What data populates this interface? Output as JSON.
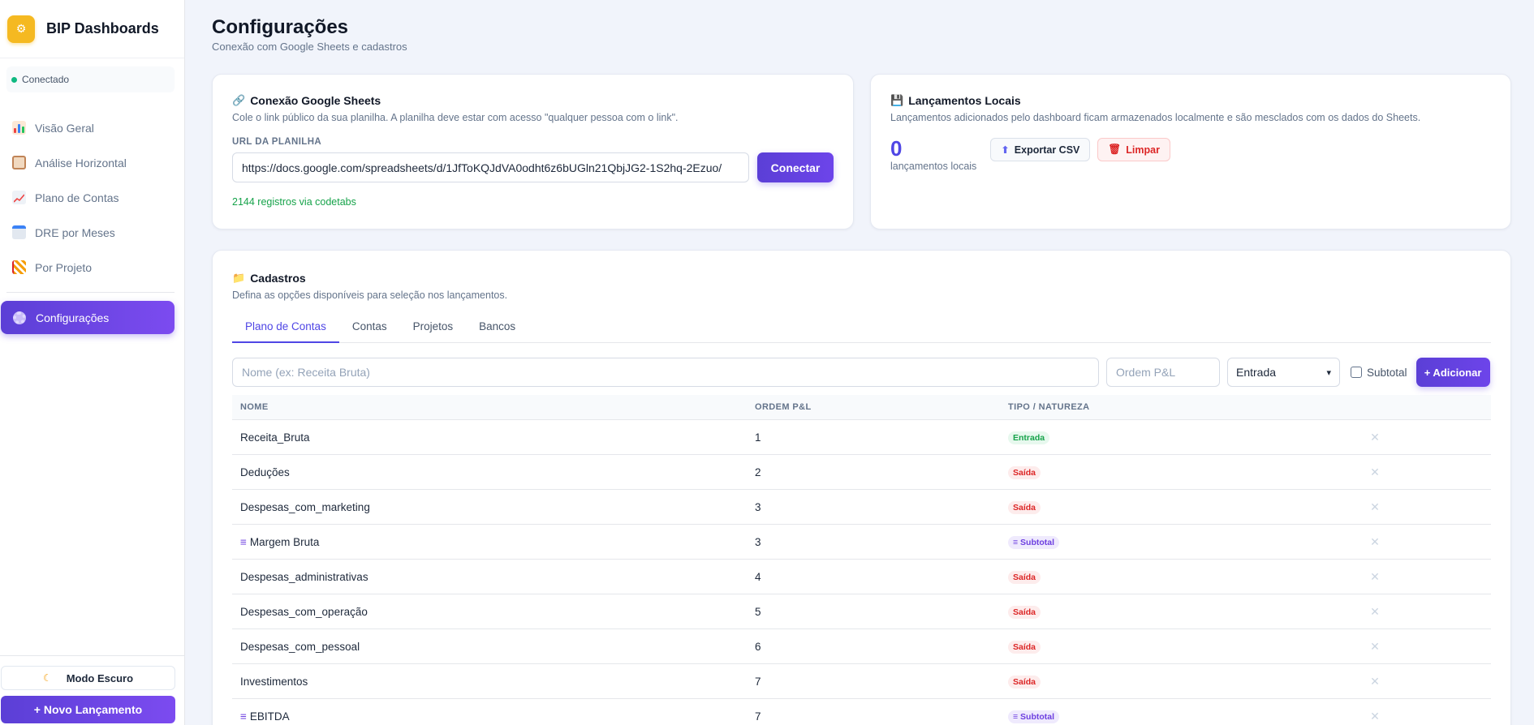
{
  "brand": {
    "name": "BIP Dashboards"
  },
  "status": {
    "text": "Conectado"
  },
  "nav": [
    {
      "label": "Visão Geral",
      "icon": "bar-chart-icon"
    },
    {
      "label": "Análise Horizontal",
      "icon": "clipboard-icon"
    },
    {
      "label": "Plano de Contas",
      "icon": "line-chart-icon"
    },
    {
      "label": "DRE por Meses",
      "icon": "calendar-icon"
    },
    {
      "label": "Por Projeto",
      "icon": "construction-icon"
    }
  ],
  "nav_active": {
    "label": "Configurações"
  },
  "sidebar_bottom": {
    "dark_mode": "Modo Escuro",
    "new_entry": "+ Novo Lançamento"
  },
  "page": {
    "title": "Configurações",
    "subtitle": "Conexão com Google Sheets e cadastros"
  },
  "sheets": {
    "title": "Conexão Google Sheets",
    "desc": "Cole o link público da sua planilha. A planilha deve estar com acesso \"qualquer pessoa com o link\".",
    "url_label": "URL DA PLANILHA",
    "url_value": "https://docs.google.com/spreadsheets/d/1JfToKQJdVA0odht6z6bUGln21QbjJG2-1S2hq-2Ezuo/",
    "connect": "Conectar",
    "records": "2144 registros via codetabs"
  },
  "local": {
    "title": "Lançamentos Locais",
    "desc": "Lançamentos adicionados pelo dashboard ficam armazenados localmente e são mesclados com os dados do Sheets.",
    "count": "0",
    "count_label": "lançamentos locais",
    "export": "Exportar CSV",
    "clear": "Limpar"
  },
  "cadastros": {
    "title": "Cadastros",
    "desc": "Defina as opções disponíveis para seleção nos lançamentos.",
    "tabs": [
      "Plano de Contas",
      "Contas",
      "Projetos",
      "Bancos"
    ],
    "form": {
      "name_placeholder": "Nome (ex: Receita Bruta)",
      "order_placeholder": "Ordem P&L",
      "type_selected": "Entrada",
      "subtotal_label": "Subtotal",
      "add": "+ Adicionar"
    },
    "columns": [
      "NOME",
      "ORDEM P&L",
      "TIPO / NATUREZA"
    ],
    "rows": [
      {
        "name": "Receita_Bruta",
        "order": "1",
        "type": "Entrada",
        "kind": "in",
        "subtotal": false
      },
      {
        "name": "Deduções",
        "order": "2",
        "type": "Saída",
        "kind": "out",
        "subtotal": false
      },
      {
        "name": "Despesas_com_marketing",
        "order": "3",
        "type": "Saída",
        "kind": "out",
        "subtotal": false
      },
      {
        "name": "Margem Bruta",
        "order": "3",
        "type": "≡ Subtotal",
        "kind": "sub",
        "subtotal": true
      },
      {
        "name": "Despesas_administrativas",
        "order": "4",
        "type": "Saída",
        "kind": "out",
        "subtotal": false
      },
      {
        "name": "Despesas_com_operação",
        "order": "5",
        "type": "Saída",
        "kind": "out",
        "subtotal": false
      },
      {
        "name": "Despesas_com_pessoal",
        "order": "6",
        "type": "Saída",
        "kind": "out",
        "subtotal": false
      },
      {
        "name": "Investimentos",
        "order": "7",
        "type": "Saída",
        "kind": "out",
        "subtotal": false
      },
      {
        "name": "EBITDA",
        "order": "7",
        "type": "≡ Subtotal",
        "kind": "sub",
        "subtotal": true
      }
    ]
  },
  "colors": {
    "accent": "#5b3fd6",
    "success": "#16a34a",
    "danger": "#dc2626",
    "brand_logo": "#f5b921"
  }
}
